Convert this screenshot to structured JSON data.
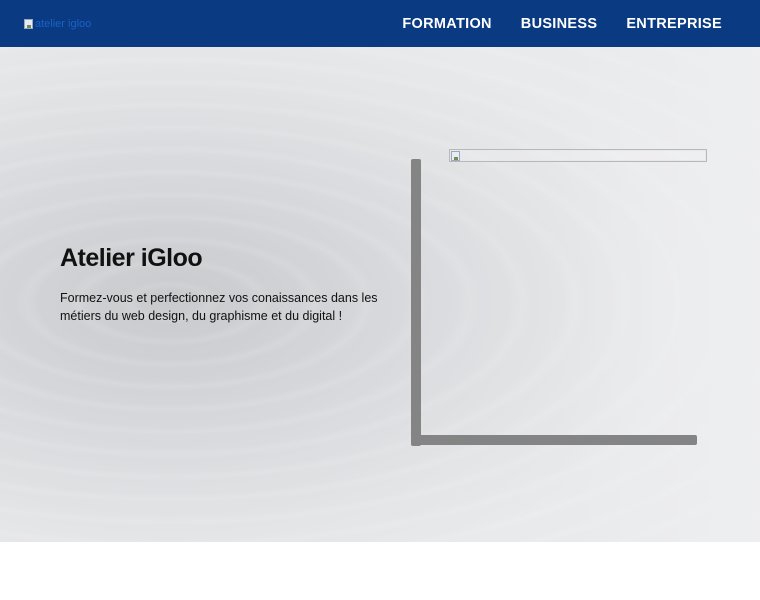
{
  "header": {
    "logo_alt": "atelier igloo",
    "nav": [
      {
        "label": "FORMATION"
      },
      {
        "label": "BUSINESS"
      },
      {
        "label": "ENTREPRISE"
      }
    ]
  },
  "hero": {
    "title": "Atelier iGloo",
    "description": "Formez-vous et perfectionnez vos conaissances dans les métiers du web design, du graphisme et du digital !"
  },
  "colors": {
    "header_bg": "#0a3a82",
    "nav_text": "#ffffff",
    "frame": "#848484"
  },
  "icons": {
    "logo": "broken-image-icon",
    "hero_image": "broken-image-icon"
  }
}
